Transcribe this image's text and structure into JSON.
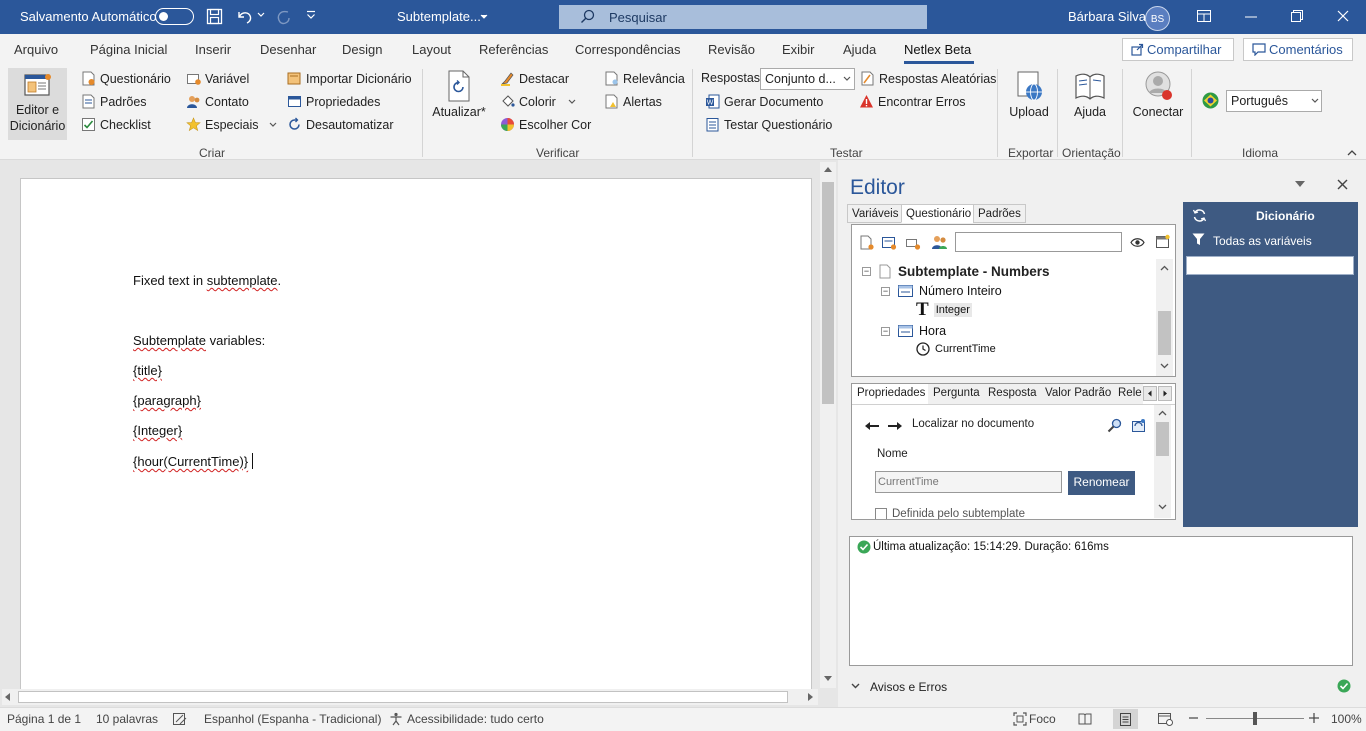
{
  "title_bar": {
    "autosave_label": "Salvamento Automático",
    "doc_title": "Subtemplate...",
    "search_placeholder": "Pesquisar",
    "user_name": "Bárbara Silva",
    "user_initials": "BS"
  },
  "tabs": [
    "Arquivo",
    "Página Inicial",
    "Inserir",
    "Desenhar",
    "Design",
    "Layout",
    "Referências",
    "Correspondências",
    "Revisão",
    "Exibir",
    "Ajuda",
    "Netlex Beta"
  ],
  "active_tab": "Netlex Beta",
  "share_label": "Compartilhar",
  "comments_label": "Comentários",
  "ribbon": {
    "editor_button": [
      "Editor e",
      "Dicionário"
    ],
    "criar": {
      "col1": [
        "Questionário",
        "Padrões",
        "Checklist"
      ],
      "col2": [
        "Variável",
        "Contato",
        "Especiais"
      ],
      "col3": [
        "Importar Dicionário",
        "Propriedades",
        "Desautomatizar"
      ],
      "group_label": "Criar"
    },
    "atualizar_label": "Atualizar*",
    "verificar": {
      "col1": [
        "Destacar",
        "Colorir",
        "Escolher Cor"
      ],
      "col2": [
        "Relevância",
        "Alertas"
      ],
      "group_label": "Verificar"
    },
    "testar": {
      "respostas_label": "Respostas:",
      "respostas_value": "Conjunto d...",
      "items": [
        "Respostas Aleatórias",
        "Gerar Documento",
        "Encontrar Erros",
        "Testar Questionário"
      ],
      "group_label": "Testar"
    },
    "upload_label": "Upload",
    "exportar_label": "Exportar",
    "ajuda_label": "Ajuda",
    "orientacao_label": "Orientação",
    "conectar_label": "Conectar",
    "idioma_value": "Português",
    "idioma_label": "Idioma"
  },
  "document": {
    "line1_a": "Fixed text in ",
    "line1_b": "subtemplate",
    "line1_c": ".",
    "line2_a": "Subtemplate",
    "line2_b": " variables:",
    "var1": "{title}",
    "var2": "{paragraph}",
    "var3": "{Integer}",
    "var4": "{hour(CurrentTime)}"
  },
  "editor_panel": {
    "title": "Editor",
    "tabs": [
      "Variáveis",
      "Questionário",
      "Padrões"
    ],
    "active_tab": "Questionário",
    "tree": {
      "root": "Subtemplate - Numbers",
      "q1": "Número Inteiro",
      "q1_var": "Integer",
      "q2": "Hora",
      "q2_var": "CurrentTime"
    },
    "prop_tabs": [
      "Propriedades",
      "Pergunta",
      "Resposta",
      "Valor Padrão",
      "Rele"
    ],
    "locate_label": "Localizar no documento",
    "name_label": "Nome",
    "name_value": "CurrentTime",
    "rename_button": "Renomear",
    "defined_label": "Definida pelo subtemplate",
    "log_text": "Última atualização: 15:14:29. Duração: 616ms",
    "warnings_label": "Avisos e Erros"
  },
  "dictionary": {
    "title": "Dicionário",
    "filter_label": "Todas as variáveis"
  },
  "status_bar": {
    "page": "Página 1 de 1",
    "words": "10 palavras",
    "language": "Espanhol (Espanha - Tradicional)",
    "accessibility": "Acessibilidade: tudo certo",
    "focus": "Foco",
    "zoom": "100%"
  },
  "colors": {
    "brand_blue": "#2b579a",
    "panel_navy": "#3e5a82",
    "success_green": "#3aa757"
  }
}
